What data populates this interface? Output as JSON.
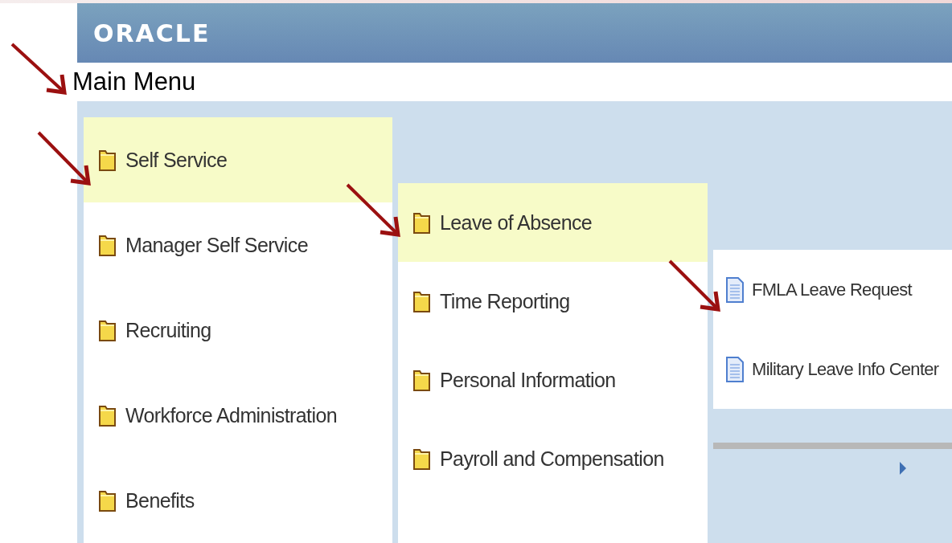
{
  "header": {
    "logo": "ORACLE"
  },
  "heading": "Main Menu",
  "menu_columns": [
    {
      "items": [
        {
          "label": "Self Service",
          "kind": "folder",
          "selected": true
        },
        {
          "label": "Manager Self Service",
          "kind": "folder",
          "selected": false
        },
        {
          "label": "Recruiting",
          "kind": "folder",
          "selected": false
        },
        {
          "label": "Workforce Administration",
          "kind": "folder",
          "selected": false
        },
        {
          "label": "Benefits",
          "kind": "folder",
          "selected": false
        }
      ]
    },
    {
      "items": [
        {
          "label": "Leave of Absence",
          "kind": "folder",
          "selected": true
        },
        {
          "label": "Time Reporting",
          "kind": "folder",
          "selected": false
        },
        {
          "label": "Personal Information",
          "kind": "folder",
          "selected": false
        },
        {
          "label": "Payroll and Compensation",
          "kind": "folder",
          "selected": false
        }
      ]
    },
    {
      "items": [
        {
          "label": "FMLA Leave Request",
          "kind": "page",
          "selected": false
        },
        {
          "label": "Military Leave Info Center",
          "kind": "page",
          "selected": false
        }
      ]
    }
  ]
}
